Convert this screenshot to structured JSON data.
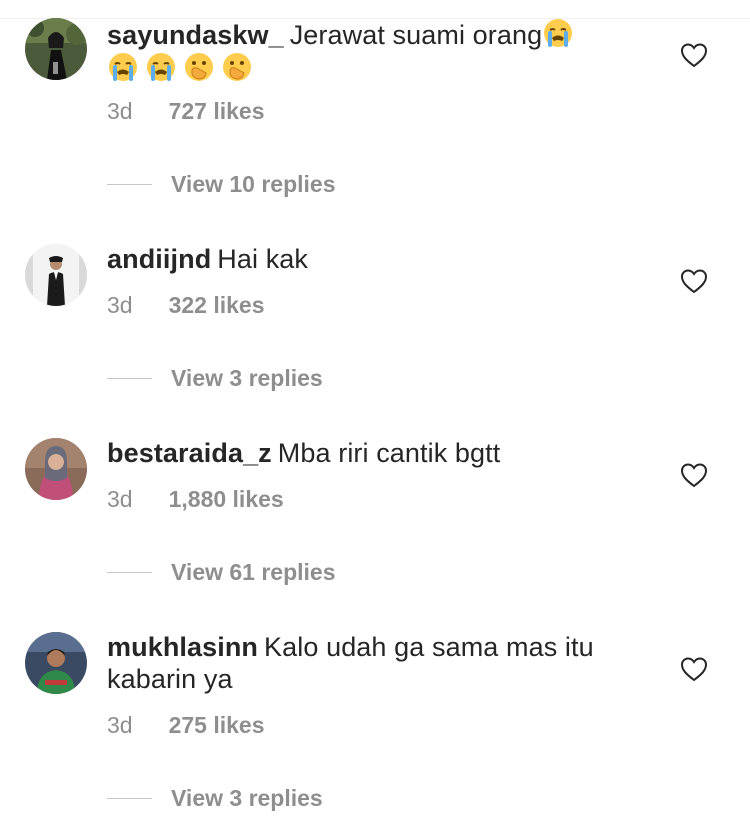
{
  "colors": {
    "text": "#262626",
    "muted": "#8e8e8e",
    "divider": "#c7c7c7",
    "heart_stroke": "#262626"
  },
  "comments": [
    {
      "username": "sayundaskw_",
      "text": "Jerawat suami orang",
      "emojis": [
        "loudly-crying-face",
        "loudly-crying-face",
        "loudly-crying-face",
        "hand-over-mouth-face",
        "hand-over-mouth-face"
      ],
      "time": "3d",
      "likes": "727 likes",
      "replies": "View 10 replies",
      "avatar": "woman-in-black-outfit"
    },
    {
      "username": "andiijnd",
      "text": "Hai kak",
      "time": "3d",
      "likes": "322 likes",
      "replies": "View 3 replies",
      "avatar": "man-in-suit-white-background"
    },
    {
      "username": "bestaraida_z",
      "text": "Mba riri cantik bgtt",
      "time": "3d",
      "likes": "1,880 likes",
      "replies": "View 61 replies",
      "avatar": "woman-in-hijab"
    },
    {
      "username": "mukhlasinn",
      "text": "Kalo udah ga sama mas itu kabarin ya",
      "time": "3d",
      "likes": "275 likes",
      "replies": "View 3 replies",
      "avatar": "man-in-green-shirt"
    }
  ]
}
